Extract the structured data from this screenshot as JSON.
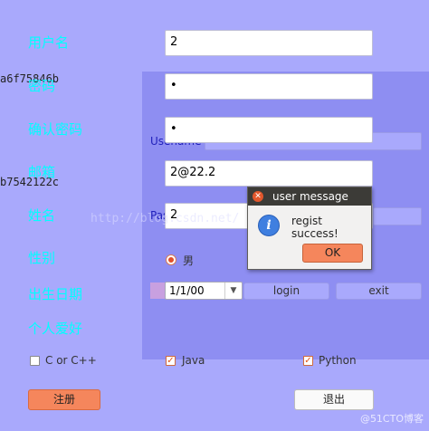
{
  "background_window": {
    "hash_1": "a6f75846b",
    "hash_2": "b7542122c",
    "username_label": "Usename",
    "username_value": "",
    "password_label": "Pas",
    "login_label": "login",
    "exit_label": "exit"
  },
  "form": {
    "labels": {
      "username": "用户名",
      "password": "密码",
      "confirm_password": "确认密码",
      "email": "邮箱",
      "name": "姓名",
      "gender": "性别",
      "birthdate": "出生日期",
      "hobbies": "个人爱好"
    },
    "values": {
      "username": "2",
      "password": "•",
      "confirm_password": "•",
      "email": "2@22.2",
      "name": "2"
    },
    "gender_option": "男",
    "birthdate_value": "1/1/00",
    "hobbies": [
      {
        "label": "C or C++",
        "checked": false
      },
      {
        "label": "Java",
        "checked": true
      },
      {
        "label": "Python",
        "checked": true
      }
    ],
    "register_label": "注册",
    "exit_label": "退出"
  },
  "dialog": {
    "title": "user message",
    "message": "regist success!",
    "ok_label": "OK",
    "icon": "info-icon"
  },
  "watermark": "http://blog.csdn.net/",
  "site_badge": "@51CTO博客",
  "colors": {
    "background": "#a9a9fc",
    "label": "#00ffff",
    "accent": "#f5865c",
    "dialog_titlebar": "#3c3b37"
  }
}
